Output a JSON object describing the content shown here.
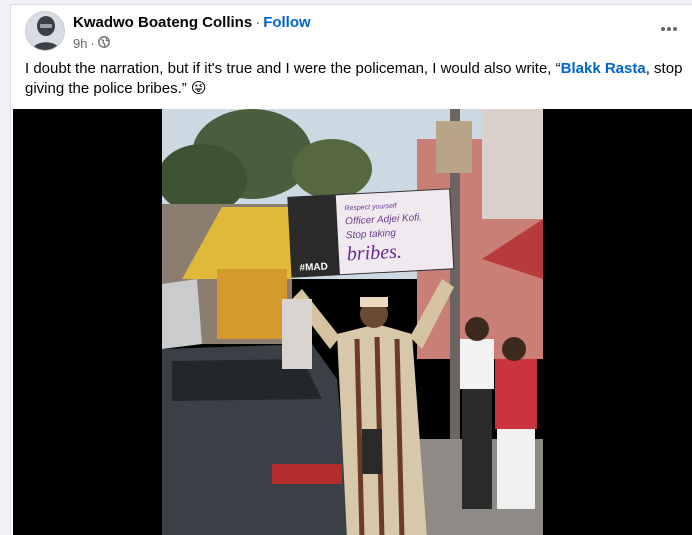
{
  "post": {
    "author": "Kwadwo Boateng Collins",
    "separator": "·",
    "follow_label": "Follow",
    "time": "9h",
    "time_separator": "·",
    "privacy_icon": "globe-icon",
    "more_icon": "more-horizontal-icon",
    "text_before": "I doubt the narration, but if it's true and I were the policeman, I would also write, “",
    "mention": "Blakk Rasta",
    "text_after": ", stop giving the police bribes.” 😜"
  },
  "video": {
    "sign_line1": "Respect yourself",
    "sign_line2": "Officer Adjei Kofi.",
    "sign_line3": "Stop taking",
    "sign_line4": "bribes.",
    "sign_tag": "#MAD"
  },
  "colors": {
    "accent": "#0064d1",
    "text": "#050505",
    "secondary": "#65676b"
  }
}
